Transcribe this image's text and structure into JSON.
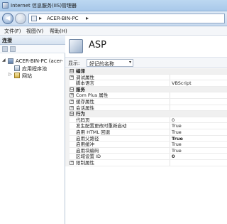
{
  "window": {
    "title": "Internet 信息服务(IIS)管理器"
  },
  "address": {
    "crumb": "ACER-BIN-PC",
    "sep1": "▸",
    "sep2": "▸"
  },
  "menu": {
    "file": "文件(F)",
    "view": "视图(V)",
    "help": "帮助(H)"
  },
  "connections": {
    "header": "连接",
    "tree": [
      {
        "label": "ACER-BIN-PC (acer-",
        "expander": "◢",
        "icon": "computer-icon"
      },
      {
        "label": "应用程序池",
        "expander": "",
        "icon": "app-pool-icon"
      },
      {
        "label": "网站",
        "expander": "▷",
        "icon": "sites-folder-icon"
      }
    ]
  },
  "feature": {
    "title": "ASP",
    "icon": "asp-feature-icon"
  },
  "display": {
    "label": "显示:",
    "value": "好记的名称"
  },
  "properties": [
    {
      "name": "编译",
      "value": "",
      "type": "section",
      "expander": "⊟"
    },
    {
      "name": "调试属性",
      "value": "",
      "type": "collapsed",
      "expander": "+"
    },
    {
      "name": "脚本语言",
      "value": "VBScript",
      "type": "item"
    },
    {
      "name": "服务",
      "value": "",
      "type": "section",
      "expander": "⊟"
    },
    {
      "name": "Com Plus 属性",
      "value": "",
      "type": "collapsed",
      "expander": "+"
    },
    {
      "name": "缓存属性",
      "value": "",
      "type": "collapsed",
      "expander": "+"
    },
    {
      "name": "会话属性",
      "value": "",
      "type": "collapsed",
      "expander": "+"
    },
    {
      "name": "行为",
      "value": "",
      "type": "section",
      "expander": "⊟"
    },
    {
      "name": "代码页",
      "value": "0",
      "type": "item"
    },
    {
      "name": "发生配置更改时重新启动",
      "value": "True",
      "type": "item"
    },
    {
      "name": "启用 HTML 回退",
      "value": "True",
      "type": "item"
    },
    {
      "name": "启用父路径",
      "value": "True",
      "type": "item",
      "bold": true
    },
    {
      "name": "启用缓冲",
      "value": "True",
      "type": "item"
    },
    {
      "name": "启用块编码",
      "value": "True",
      "type": "item"
    },
    {
      "name": "区域设置 ID",
      "value": "0",
      "type": "item",
      "bold": true
    },
    {
      "name": "限制属性",
      "value": "",
      "type": "collapsed",
      "expander": "+"
    }
  ]
}
